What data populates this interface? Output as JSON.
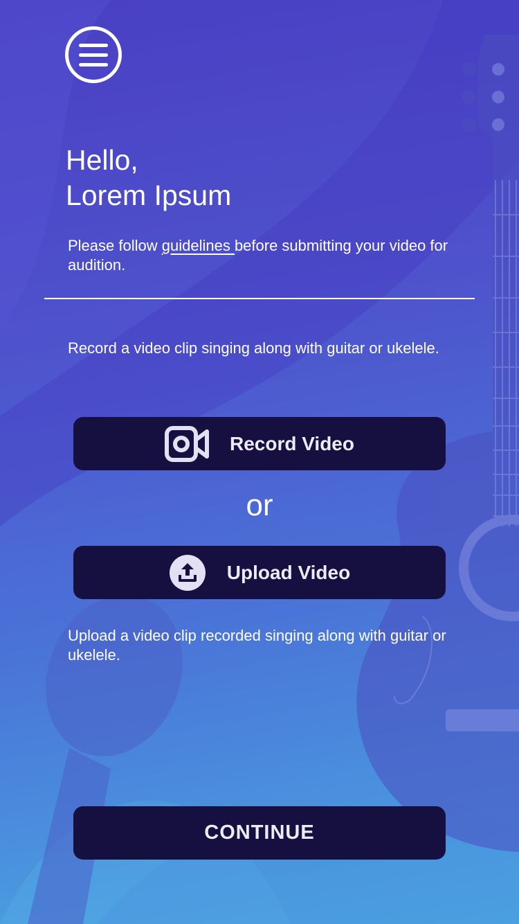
{
  "greeting": {
    "line1": "Hello,",
    "line2": "Lorem Ipsum"
  },
  "guidelines_note": {
    "prefix": "Please follow ",
    "link": "guidelines ",
    "suffix": "before submitting your video for audition."
  },
  "record_description": "Record a video clip singing along with guitar or ukelele.",
  "record_button": {
    "label": "Record Video",
    "icon": "video-camera-icon"
  },
  "or_text": "or",
  "upload_button": {
    "label": "Upload Video",
    "icon": "upload-icon"
  },
  "upload_description": "Upload a video clip recorded singing along with guitar or ukelele.",
  "continue_button": {
    "label": "CONTINUE"
  },
  "colors": {
    "background_top": "#4a3fc4",
    "background_bottom": "#4aa8e2",
    "button_background": "#151040",
    "text": "#ffffff"
  }
}
